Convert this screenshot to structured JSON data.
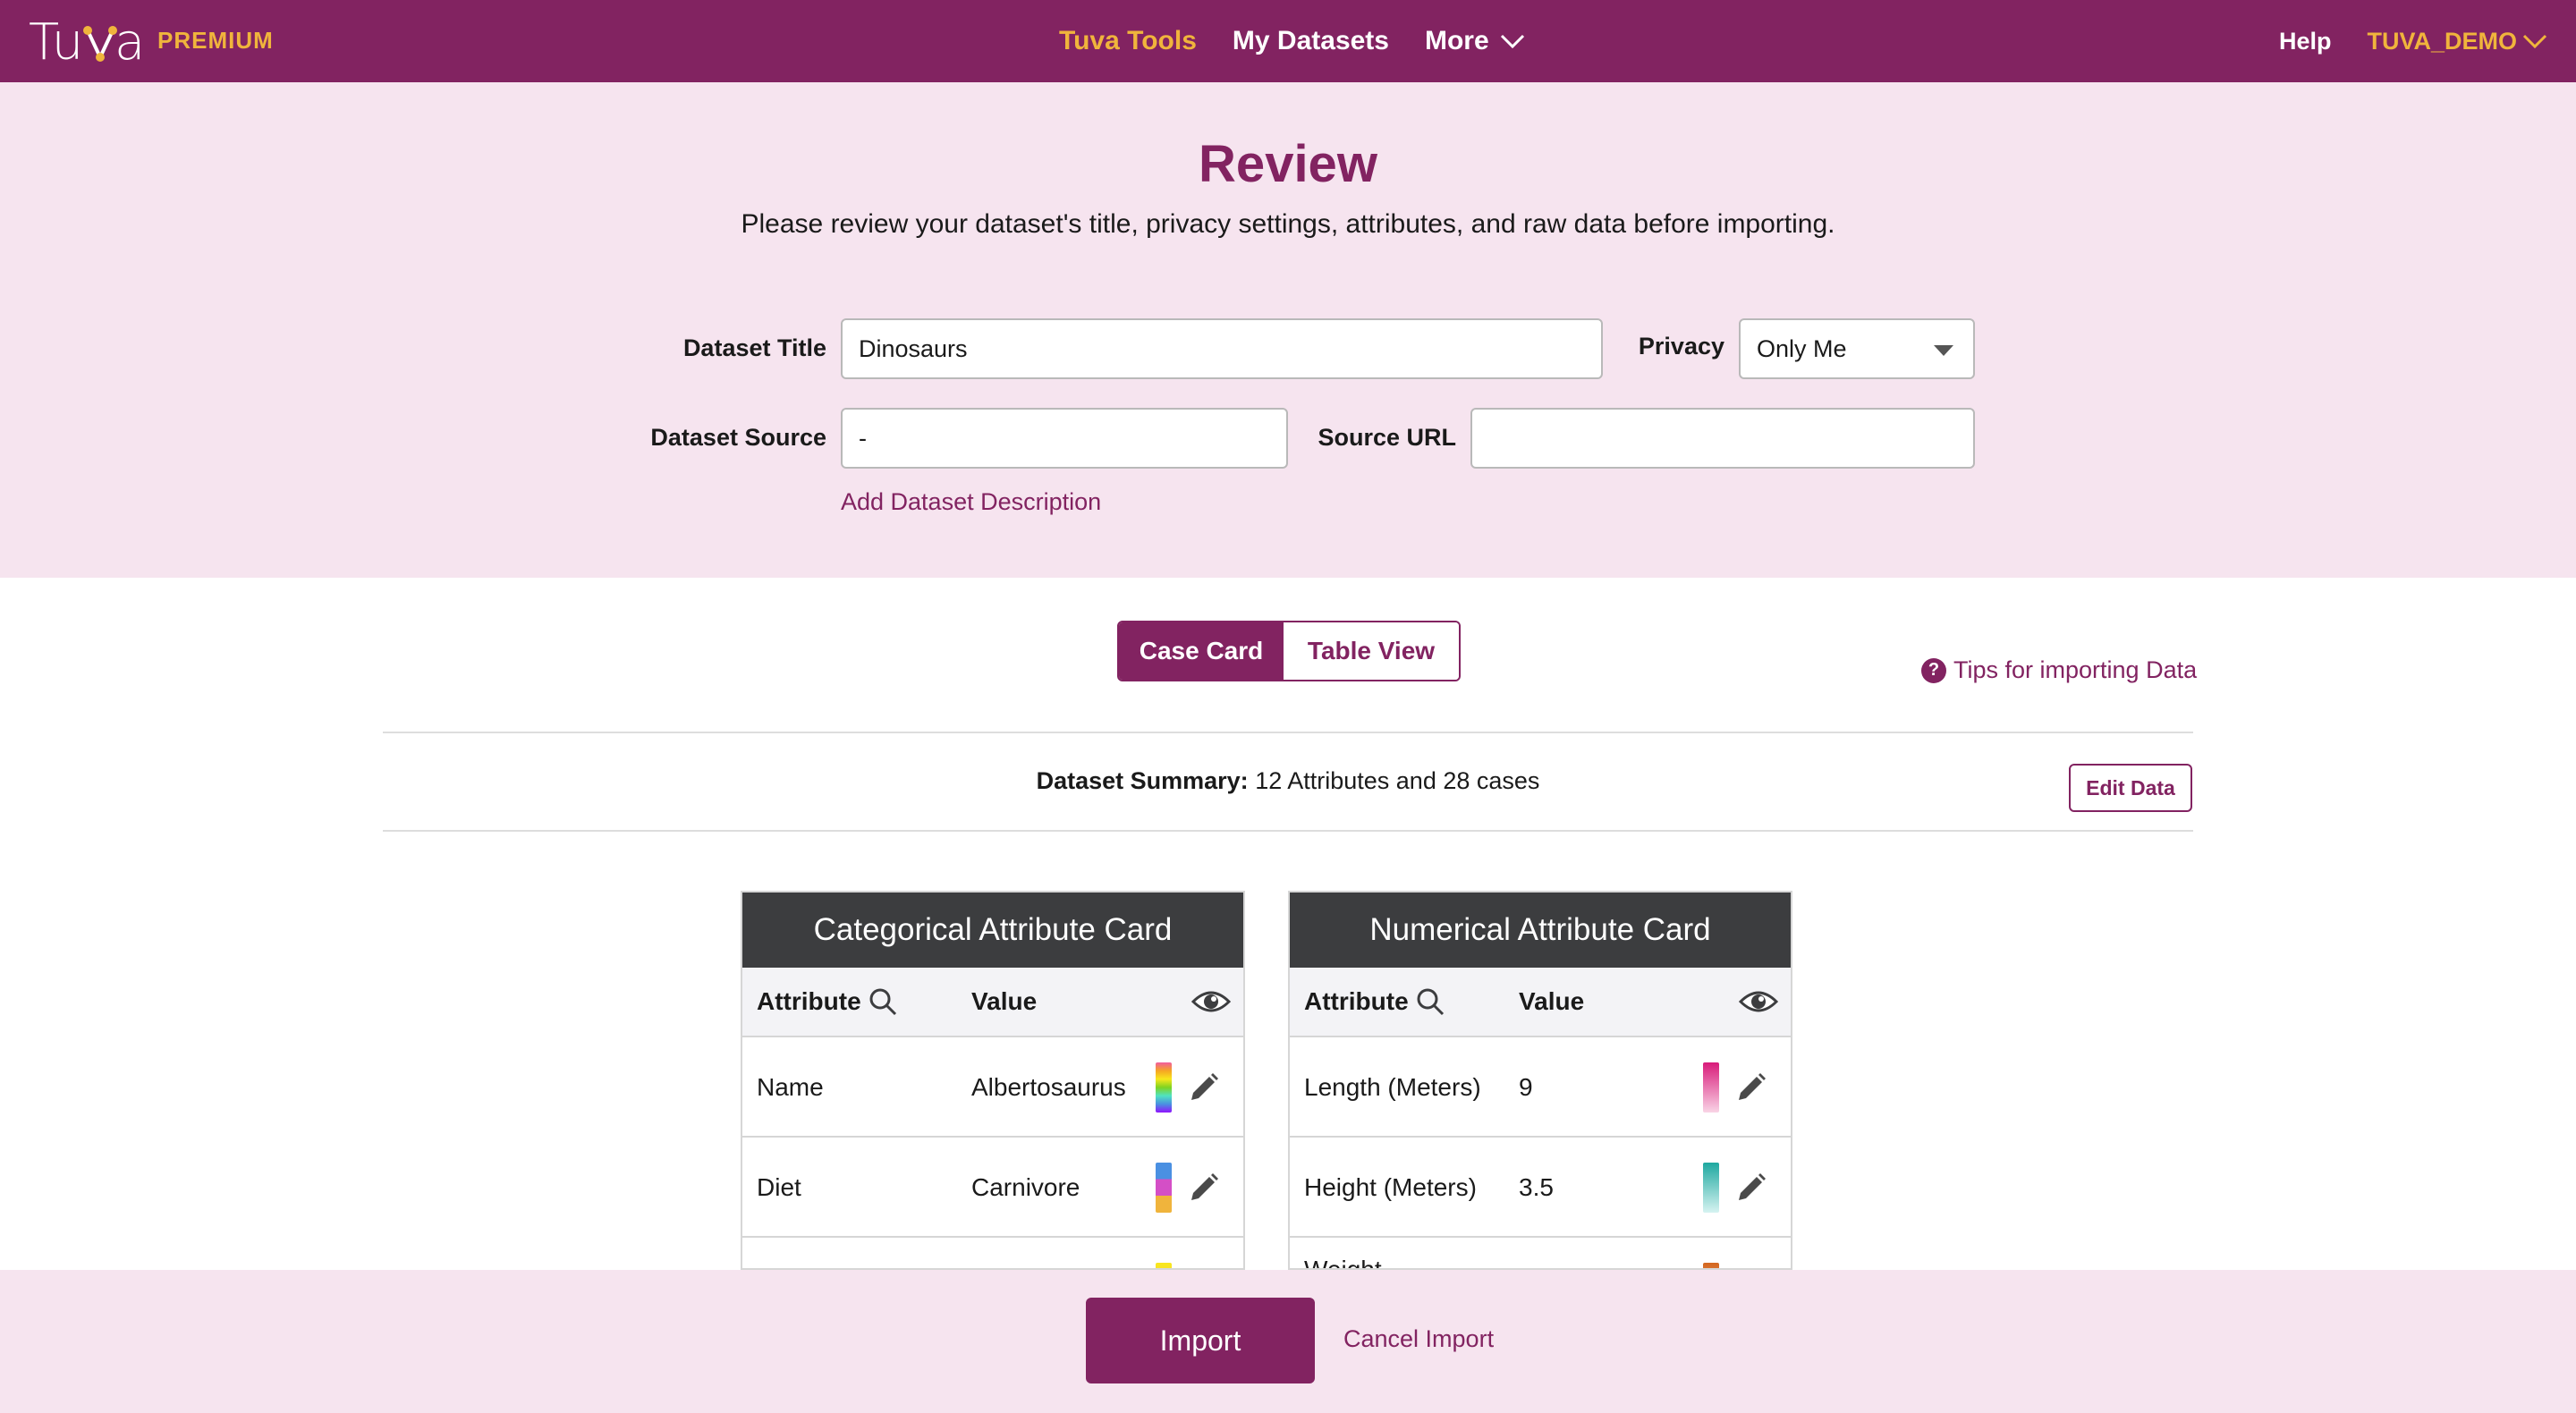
{
  "nav": {
    "logo": "Tuva",
    "badge": "PREMIUM",
    "links": [
      {
        "label": "Tuva Tools",
        "active": true
      },
      {
        "label": "My Datasets",
        "active": false
      },
      {
        "label": "More",
        "active": false
      }
    ],
    "help": "Help",
    "user": "TUVA_DEMO",
    "accent_color": "#f0b43c",
    "brand_color": "#822361"
  },
  "review": {
    "title": "Review",
    "subtitle": "Please review your dataset's title, privacy settings, attributes, and raw data before importing.",
    "dataset_title_label": "Dataset Title",
    "dataset_title_value": "Dinosaurs",
    "privacy_label": "Privacy",
    "privacy_value": "Only Me",
    "dataset_source_label": "Dataset Source",
    "dataset_source_value": "-",
    "source_url_label": "Source URL",
    "source_url_value": "",
    "add_description": "Add Dataset Description"
  },
  "view_toggle": {
    "case_card": "Case Card",
    "table_view": "Table View",
    "selected": "Case Card"
  },
  "tips": "Tips for importing Data",
  "summary": {
    "label": "Dataset Summary:",
    "text": "12 Attributes and 28 cases",
    "edit_button": "Edit Data"
  },
  "cards": {
    "categorical": {
      "title": "Categorical Attribute Card",
      "col_attribute": "Attribute",
      "col_value": "Value",
      "rows": [
        {
          "attribute": "Name",
          "value": "Albertosaurus",
          "swatch_icon": "rainbow-palette"
        },
        {
          "attribute": "Diet",
          "value": "Carnivore",
          "swatch_icon": "categorical-palette"
        }
      ]
    },
    "numerical": {
      "title": "Numerical Attribute Card",
      "col_attribute": "Attribute",
      "col_value": "Value",
      "rows": [
        {
          "attribute": "Length (Meters)",
          "value": "9",
          "swatch_icon": "pink-gradient"
        },
        {
          "attribute": "Height (Meters)",
          "value": "3.5",
          "swatch_icon": "teal-gradient"
        },
        {
          "attribute": "Weight",
          "value": "",
          "swatch_icon": "orange-gradient"
        }
      ]
    }
  },
  "footer": {
    "import": "Import",
    "cancel": "Cancel Import"
  }
}
